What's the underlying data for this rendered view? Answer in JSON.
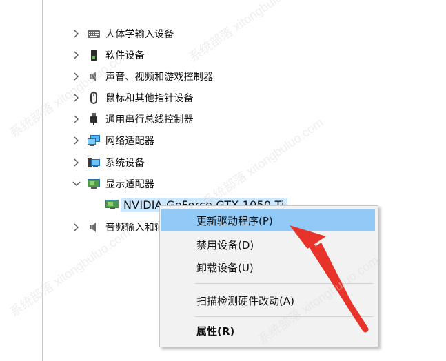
{
  "tree": {
    "items": [
      {
        "label": "人体学输入设备",
        "icon": "keyboard-icon"
      },
      {
        "label": "软件设备",
        "icon": "software-device-icon"
      },
      {
        "label": "声音、视频和游戏控制器",
        "icon": "speaker-icon"
      },
      {
        "label": "鼠标和其他指针设备",
        "icon": "mouse-icon"
      },
      {
        "label": "通用串行总线控制器",
        "icon": "usb-icon"
      },
      {
        "label": "网络适配器",
        "icon": "network-adapter-icon"
      },
      {
        "label": "系统设备",
        "icon": "system-device-icon"
      },
      {
        "label": "显示适配器",
        "icon": "display-adapter-icon",
        "expanded": true
      },
      {
        "label": "NVIDIA GeForce GTX 1050 Ti",
        "icon": "gpu-icon",
        "selected": true
      },
      {
        "label": "音频输入和输出",
        "icon": "audio-io-icon"
      }
    ]
  },
  "context_menu": {
    "items": [
      {
        "label": "更新驱动程序(P)",
        "highlighted": true
      },
      {
        "label": "禁用设备(D)"
      },
      {
        "label": "卸载设备(U)"
      },
      {
        "label": "扫描检测硬件改动(A)"
      },
      {
        "label": "属性(R)",
        "bold": true
      }
    ]
  },
  "colors": {
    "selection": "#cce8ff",
    "menu_highlight": "#91c9f7",
    "arrow": "#e8332a"
  },
  "watermark": "系统部落 xitongbuluo.com"
}
